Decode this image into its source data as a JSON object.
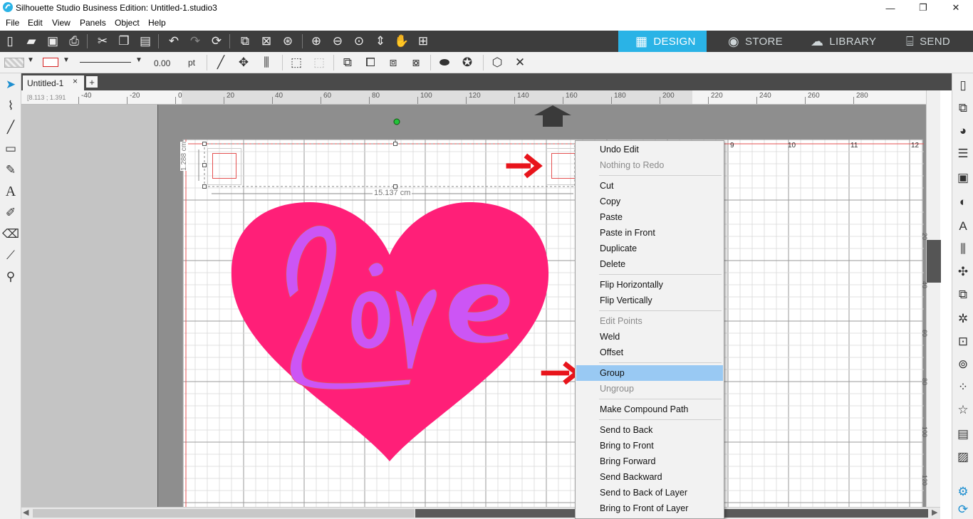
{
  "window": {
    "title": "Silhouette Studio Business Edition: Untitled-1.studio3",
    "minimize": "—",
    "restore": "❐",
    "close": "✕"
  },
  "menubar": [
    "File",
    "Edit",
    "View",
    "Panels",
    "Object",
    "Help"
  ],
  "mode_tabs": {
    "design": "DESIGN",
    "store": "STORE",
    "library": "LIBRARY",
    "send": "SEND",
    "active": "design"
  },
  "toolbar2": {
    "line_width_value": "0.00",
    "line_width_unit": "pt"
  },
  "document": {
    "tab_label": "Untitled-1",
    "tab_close": "×",
    "add_tab": "+"
  },
  "ruler": {
    "coords": "[8.113 ; 1.391",
    "labels": [
      "-40",
      "-20",
      "0",
      "20",
      "40",
      "60",
      "80",
      "100",
      "120",
      "140",
      "160",
      "180",
      "200",
      "220",
      "240",
      "260",
      "280"
    ]
  },
  "vertical_ruler_labels": [
    "20",
    "40",
    "60",
    "80",
    "100",
    "120"
  ],
  "canvas": {
    "width_label": "15.137 cm",
    "height_label": "1.288 cm",
    "grid_numbers": [
      "9",
      "10",
      "11",
      "12"
    ],
    "design_text": "Love",
    "colors": {
      "heart": "#ff1f78",
      "text": "#cc55f5",
      "cut_line": "#e45050",
      "annotation_arrow": "#e8141b",
      "selection_handle": "#22c33a"
    }
  },
  "context_menu": {
    "items": [
      {
        "label": "Undo Edit",
        "enabled": true
      },
      {
        "label": "Nothing to Redo",
        "enabled": false
      },
      {
        "separator": true
      },
      {
        "label": "Cut",
        "enabled": true
      },
      {
        "label": "Copy",
        "enabled": true
      },
      {
        "label": "Paste",
        "enabled": true
      },
      {
        "label": "Paste in Front",
        "enabled": true
      },
      {
        "label": "Duplicate",
        "enabled": true
      },
      {
        "label": "Delete",
        "enabled": true
      },
      {
        "separator": true
      },
      {
        "label": "Flip Horizontally",
        "enabled": true
      },
      {
        "label": "Flip Vertically",
        "enabled": true
      },
      {
        "separator": true
      },
      {
        "label": "Edit Points",
        "enabled": false
      },
      {
        "label": "Weld",
        "enabled": true
      },
      {
        "label": "Offset",
        "enabled": true
      },
      {
        "separator": true
      },
      {
        "label": "Group",
        "enabled": true,
        "highlighted": true
      },
      {
        "label": "Ungroup",
        "enabled": false
      },
      {
        "separator": true
      },
      {
        "label": "Make Compound Path",
        "enabled": true
      },
      {
        "separator": true
      },
      {
        "label": "Send to Back",
        "enabled": true
      },
      {
        "label": "Bring to Front",
        "enabled": true
      },
      {
        "label": "Bring Forward",
        "enabled": true
      },
      {
        "label": "Send Backward",
        "enabled": true
      },
      {
        "label": "Send to Back of Layer",
        "enabled": true
      },
      {
        "label": "Bring to Front of Layer",
        "enabled": true
      }
    ]
  },
  "icons": {
    "app": "silhouette-logo-icon",
    "left_tools": [
      "select-icon",
      "point-edit-icon",
      "line-icon",
      "rectangle-icon",
      "pencil-icon",
      "text-icon",
      "sketch-icon",
      "eraser-icon",
      "knife-icon",
      "eyedropper-icon"
    ],
    "right_panel": [
      "page-setup-icon",
      "pixscan-icon",
      "fill-color-icon",
      "line-style-icon",
      "trace-icon",
      "contrast-icon",
      "text-style-icon",
      "align-icon",
      "transform-icon",
      "replicate-icon",
      "modify-icon",
      "offset-icon",
      "trace-panel-icon",
      "sketch-panel-icon",
      "library-star-icon",
      "layers-icon",
      "hatch-icon",
      "settings-icon",
      "refresh-icon"
    ]
  }
}
